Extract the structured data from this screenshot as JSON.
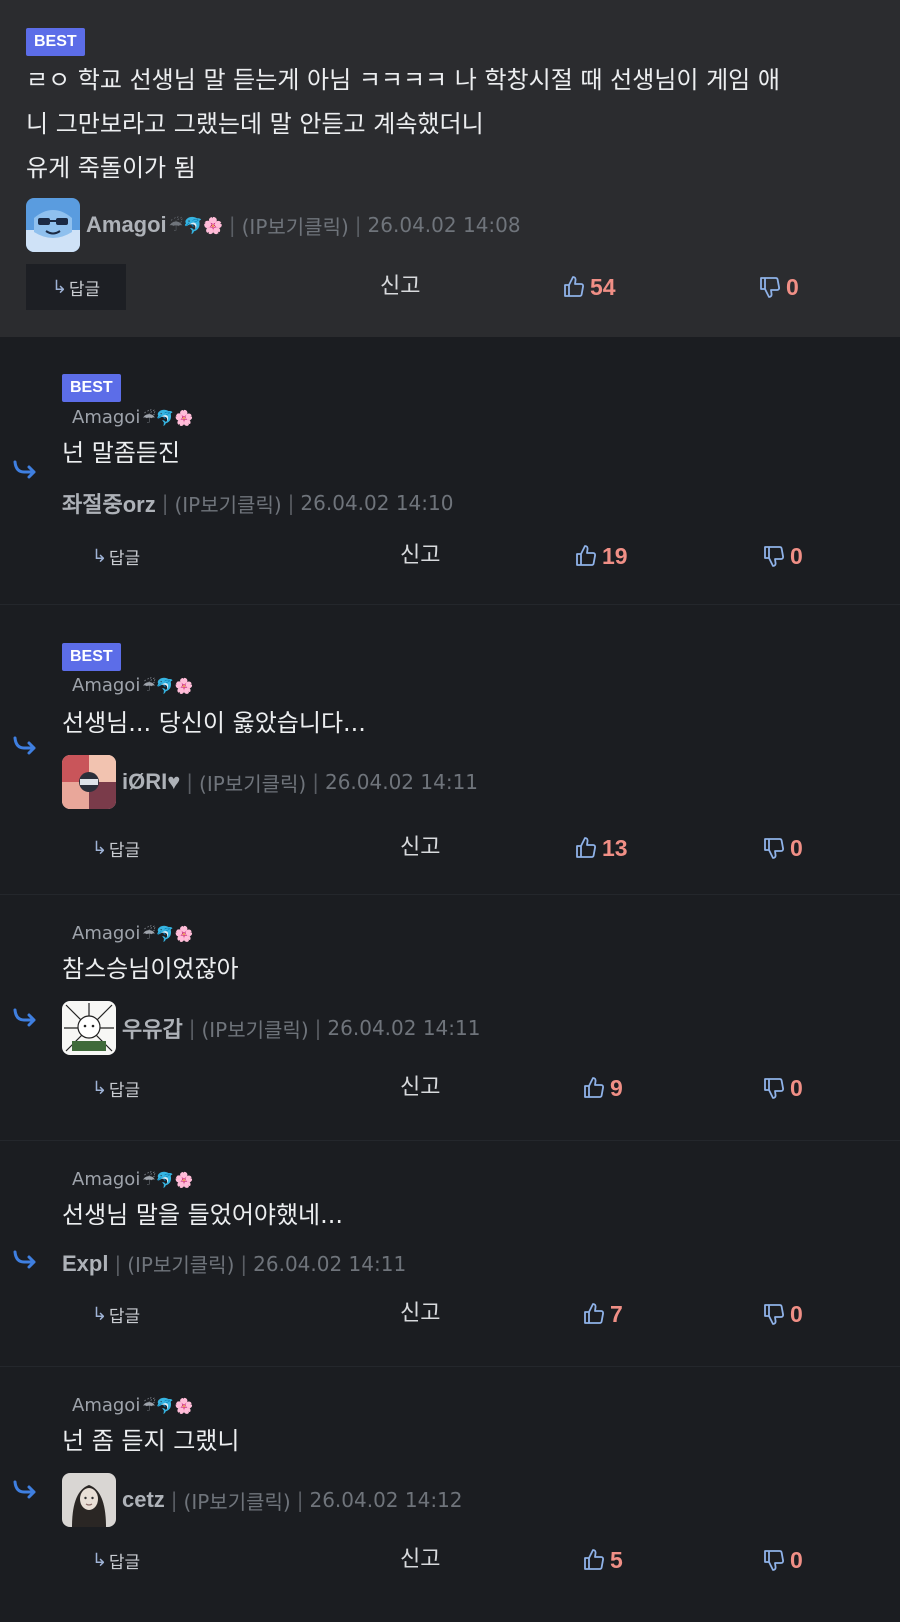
{
  "ui": {
    "best_label": "BEST",
    "reply_label": "답글",
    "report_label": "신고",
    "ip_label": "(IP보기클릭)",
    "reply_emojis": "☔🐬🌸"
  },
  "comments": [
    {
      "best": true,
      "lines": [
        "ㄹㅇ 학교 선생님 말 듣는게 아님 ㅋㅋㅋㅋ 나 학창시절 때 선생님이 게임 애",
        "니 그만보라고 그랬는데 말 안듣고 계속했더니",
        "유게 죽돌이가 됨"
      ],
      "author": "Amagoi",
      "author_emojis": "☔🐬🌸",
      "timestamp": "26.04.02 14:08",
      "upvotes": "54",
      "downvotes": "0"
    },
    {
      "best": true,
      "reply_to": "Amagoi",
      "text": "넌 말좀듣진",
      "author": "좌절중orz",
      "timestamp": "26.04.02 14:10",
      "upvotes": "19",
      "downvotes": "0"
    },
    {
      "best": true,
      "reply_to": "Amagoi",
      "text": "선생님... 당신이 옳았습니다...",
      "author": "iØRI♥",
      "timestamp": "26.04.02 14:11",
      "upvotes": "13",
      "downvotes": "0"
    },
    {
      "best": false,
      "reply_to": "Amagoi",
      "text": "참스승님이었잖아",
      "author": "우유갑",
      "timestamp": "26.04.02 14:11",
      "upvotes": "9",
      "downvotes": "0"
    },
    {
      "best": false,
      "reply_to": "Amagoi",
      "text": "선생님 말을 들었어야했네...",
      "author": "Expl",
      "timestamp": "26.04.02 14:11",
      "upvotes": "7",
      "downvotes": "0"
    },
    {
      "best": false,
      "reply_to": "Amagoi",
      "text": "넌 좀 듣지 그랬니",
      "author": "cetz",
      "timestamp": "26.04.02 14:12",
      "upvotes": "5",
      "downvotes": "0"
    }
  ],
  "colors": {
    "accent_badge": "#5c6de8",
    "vote_count": "#f08f86",
    "vote_icon": "#8fb2e8",
    "reply_arrow": "#3f7fe0"
  }
}
